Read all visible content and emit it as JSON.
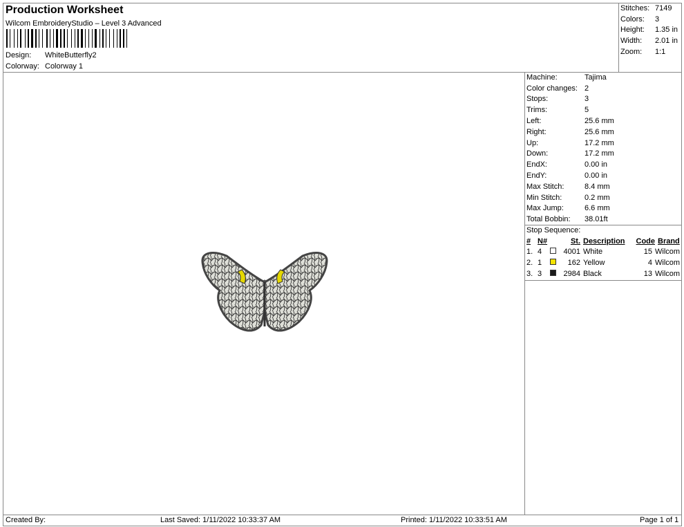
{
  "header": {
    "title": "Production Worksheet",
    "subtitle": "Wilcom EmbroideryStudio – Level 3 Advanced",
    "design_label": "Design:",
    "design": "WhiteButterfly2",
    "colorway_label": "Colorway:",
    "colorway": "Colorway 1"
  },
  "summary": [
    {
      "k": "Stitches:",
      "v": "7149"
    },
    {
      "k": "Colors:",
      "v": "3"
    },
    {
      "k": "Height:",
      "v": "1.35 in"
    },
    {
      "k": "Width:",
      "v": "2.01 in"
    },
    {
      "k": "Zoom:",
      "v": "1:1"
    }
  ],
  "details": [
    {
      "k": "Machine:",
      "v": "Tajima"
    },
    {
      "k": "Color changes:",
      "v": "2"
    },
    {
      "k": "Stops:",
      "v": "3"
    },
    {
      "k": "Trims:",
      "v": "5"
    },
    {
      "k": "Left:",
      "v": "25.6 mm"
    },
    {
      "k": "Right:",
      "v": "25.6 mm"
    },
    {
      "k": "Up:",
      "v": "17.2 mm"
    },
    {
      "k": "Down:",
      "v": "17.2 mm"
    },
    {
      "k": "EndX:",
      "v": "0.00 in"
    },
    {
      "k": "EndY:",
      "v": "0.00 in"
    },
    {
      "k": "Max Stitch:",
      "v": "8.4 mm"
    },
    {
      "k": "Min Stitch:",
      "v": "0.2 mm"
    },
    {
      "k": "Max Jump:",
      "v": "6.6 mm"
    },
    {
      "k": "Total Bobbin:",
      "v": "38.01ft"
    }
  ],
  "stop_sequence": {
    "label": "Stop Sequence:",
    "headers": [
      "#",
      "N#",
      "St.",
      "Description",
      "Code",
      "Brand"
    ],
    "rows": [
      {
        "num": "1.",
        "n": "4",
        "color": "#ffffff",
        "st": "4001",
        "desc": "White",
        "code": "15",
        "brand": "Wilcom"
      },
      {
        "num": "2.",
        "n": "1",
        "color": "#f5e400",
        "st": "162",
        "desc": "Yellow",
        "code": "4",
        "brand": "Wilcom"
      },
      {
        "num": "3.",
        "n": "3",
        "color": "#1a1a1a",
        "st": "2984",
        "desc": "Black",
        "code": "13",
        "brand": "Wilcom"
      }
    ]
  },
  "footer": {
    "created": "Created By:",
    "saved": "Last Saved: 1/11/2022 10:33:37 AM",
    "printed": "Printed: 1/11/2022 10:33:51 AM",
    "page": "Page 1 of 1"
  }
}
